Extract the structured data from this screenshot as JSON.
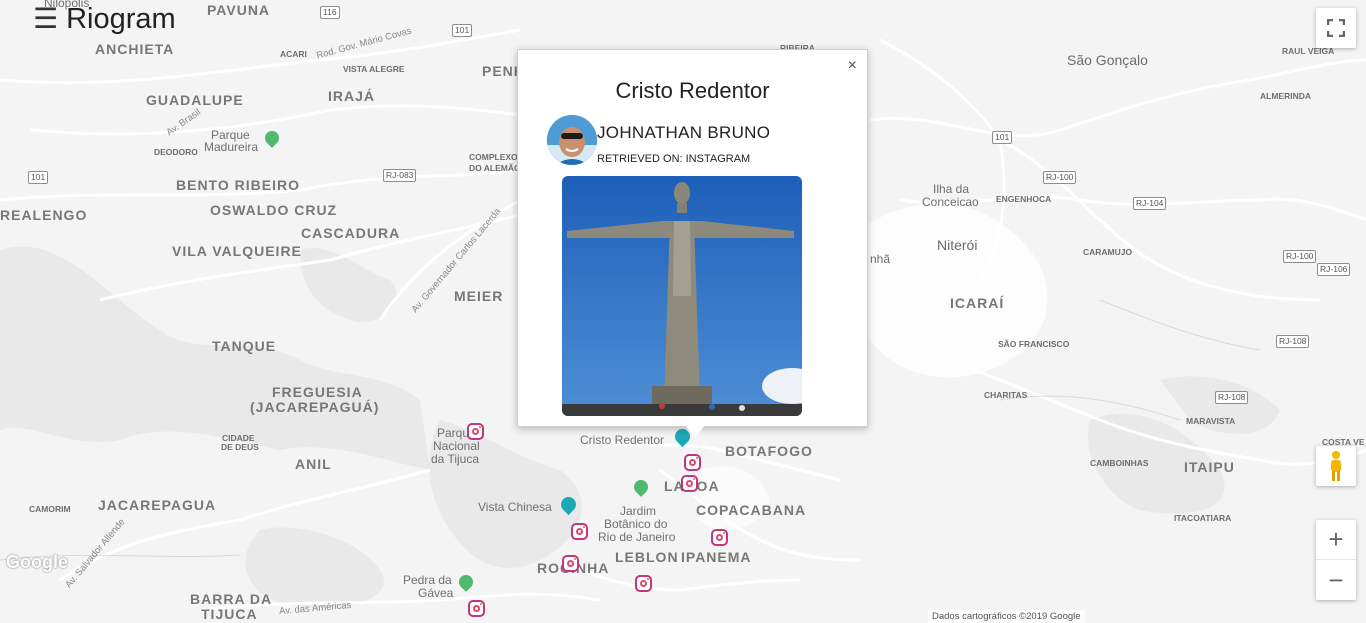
{
  "app": {
    "title": "Riogram",
    "menu_icon": "hamburger-menu-icon"
  },
  "popup": {
    "title": "Cristo Redentor",
    "close_label": "×",
    "user_name": "JOHNATHAN BRUNO",
    "retrieved_on": "RETRIEVED ON: INSTAGRAM",
    "photo_icon": "cristo-redentor-photo"
  },
  "map": {
    "neighborhoods": [
      "PAVUNA",
      "ANCHIETA",
      "GUADALUPE",
      "IRAJÁ",
      "BENTO RIBEIRO",
      "OSWALDO CRUZ",
      "CASCADURA",
      "REALENGO",
      "VILA VALQUEIRE",
      "MEIER",
      "TANQUE",
      "FREGUESIA",
      "(JACAREPAGUÁ)",
      "ANIL",
      "JACAREPAGUA",
      "BARRA DA",
      "TIJUCA",
      "ROCINHA",
      "LEBLON",
      "IPANEMA",
      "COPACABANA",
      "BOTAFOGO",
      "LAGOA",
      "ICARAÍ",
      "ITAIPU",
      "PENHA"
    ],
    "small_places": [
      "ACARI",
      "VISTA ALEGRE",
      "DEODORO",
      "COMPLEXO",
      "DO ALEMÃO",
      "CIDADE",
      "DE DEUS",
      "CAMORIM",
      "ENGENHOCA",
      "CARAMUJO",
      "ALMERINDA",
      "RAUL VEIGA",
      "SÃO FRANCISCO",
      "CHARITAS",
      "MARAVISTA",
      "CAMBOINHAS",
      "ITACOATIARA",
      "COSTA VE",
      "RIBEIRA"
    ],
    "cities": [
      "São Gonçalo",
      "Niterói",
      "Ilha da",
      "Conceicao",
      "Nilópolis"
    ],
    "streets": [
      "Rod. Gov. Mário Covas",
      "Av. Brasil",
      "Av. Governador Carlos Lacerda",
      "Av. Salvador Allende",
      "Av. das Américas"
    ],
    "pois": [
      "Parque",
      "Madureira",
      "Parque",
      "Nacional",
      "da Tijuca",
      "Cristo Redentor",
      "Vista Chinesa",
      "Jardim",
      "Botânico do",
      "Rio de Janeiro",
      "Pedra da",
      "Gávea",
      "nhã"
    ],
    "shields": [
      "116",
      "101",
      "101",
      "RJ-083",
      "101",
      "RJ-100",
      "RJ-104",
      "RJ-100",
      "RJ-106",
      "RJ-108",
      "RJ-108"
    ]
  },
  "controls": {
    "fullscreen_icon": "fullscreen-icon",
    "pegman_icon": "street-view-pegman-icon",
    "zoom_in_label": "+",
    "zoom_out_label": "−"
  },
  "footer": {
    "google_logo": "Google",
    "attribution": "Dados cartográficos ©2019 Google"
  },
  "colors": {
    "map_bg": "#f4f4f4",
    "road": "#ffffff",
    "instagram_marker": "#c2367c",
    "park_marker": "#4fb96e",
    "attraction_marker": "#1ea7b8"
  }
}
